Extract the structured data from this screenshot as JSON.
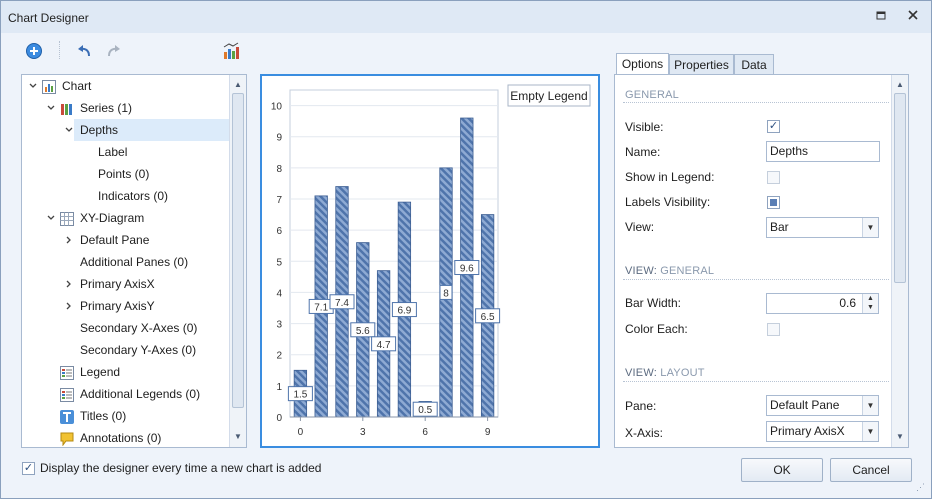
{
  "window": {
    "title": "Chart Designer"
  },
  "tree": {
    "items": [
      {
        "label": "Chart",
        "level": 0,
        "expander": "v",
        "icon": "chart-icon"
      },
      {
        "label": "Series (1)",
        "level": 1,
        "expander": "v",
        "icon": "series-icon"
      },
      {
        "label": "Depths",
        "level": 2,
        "expander": "v",
        "icon": "",
        "selected": true
      },
      {
        "label": "Label",
        "level": 3,
        "expander": "",
        "icon": ""
      },
      {
        "label": "Points (0)",
        "level": 3,
        "expander": "",
        "icon": ""
      },
      {
        "label": "Indicators (0)",
        "level": 3,
        "expander": "",
        "icon": ""
      },
      {
        "label": "XY-Diagram",
        "level": 1,
        "expander": "v",
        "icon": "diagram-icon"
      },
      {
        "label": "Default Pane",
        "level": 2,
        "expander": ">",
        "icon": ""
      },
      {
        "label": "Additional Panes (0)",
        "level": 2,
        "expander": "",
        "icon": ""
      },
      {
        "label": "Primary AxisX",
        "level": 2,
        "expander": ">",
        "icon": ""
      },
      {
        "label": "Primary AxisY",
        "level": 2,
        "expander": ">",
        "icon": ""
      },
      {
        "label": "Secondary X-Axes (0)",
        "level": 2,
        "expander": "",
        "icon": ""
      },
      {
        "label": "Secondary Y-Axes (0)",
        "level": 2,
        "expander": "",
        "icon": ""
      },
      {
        "label": "Legend",
        "level": 1,
        "expander": "",
        "icon": "legend-icon"
      },
      {
        "label": "Additional Legends (0)",
        "level": 1,
        "expander": "",
        "icon": "legends-icon"
      },
      {
        "label": "Titles (0)",
        "level": 1,
        "expander": "",
        "icon": "titles-icon"
      },
      {
        "label": "Annotations (0)",
        "level": 1,
        "expander": "",
        "icon": "annotations-icon"
      }
    ]
  },
  "chart_data": {
    "type": "bar",
    "x": [
      0,
      1,
      2,
      3,
      4,
      5,
      6,
      7,
      8,
      9
    ],
    "values": [
      1.5,
      7.1,
      7.4,
      5.6,
      4.7,
      6.9,
      0.5,
      8,
      9.6,
      6.5
    ],
    "data_labels": [
      "1.5",
      "7.1",
      "7.4",
      "5.6",
      "4.7",
      "6.9",
      "0.5",
      "8",
      "9.6",
      "6.5"
    ],
    "x_tick_labels": [
      "0",
      "3",
      "6",
      "9"
    ],
    "x_ticks": [
      0,
      3,
      6,
      9
    ],
    "y_tick_labels": [
      "0",
      "1",
      "2",
      "3",
      "4",
      "5",
      "6",
      "7",
      "8",
      "9",
      "10"
    ],
    "ylim": [
      0,
      10.5
    ],
    "legend": "Empty Legend",
    "legend_position": "top-right",
    "bar_color": "#4f74ab",
    "grid": true
  },
  "props": {
    "tabs": [
      "Options",
      "Properties",
      "Data"
    ],
    "active_tab": "Options",
    "sections": {
      "general": "GENERAL",
      "view_general_a": "VIEW:",
      "view_general_b": "GENERAL",
      "view_layout_a": "VIEW:",
      "view_layout_b": "LAYOUT"
    },
    "visible_label": "Visible:",
    "name_label": "Name:",
    "name_value": "Depths",
    "show_in_legend_label": "Show in Legend:",
    "labels_visibility_label": "Labels Visibility:",
    "view_label": "View:",
    "view_value": "Bar",
    "bar_width_label": "Bar Width:",
    "bar_width_value": "0.6",
    "color_each_label": "Color Each:",
    "pane_label": "Pane:",
    "pane_value": "Default Pane",
    "xaxis_label": "X-Axis:",
    "xaxis_value": "Primary AxisX"
  },
  "footer": {
    "checkbox_label": "Display the designer every time a new chart is added",
    "ok_label": "OK",
    "cancel_label": "Cancel"
  },
  "colors": {
    "accent": "#3a8de0",
    "selection": "#dcebfa",
    "window_bg": "#eef3fa"
  }
}
